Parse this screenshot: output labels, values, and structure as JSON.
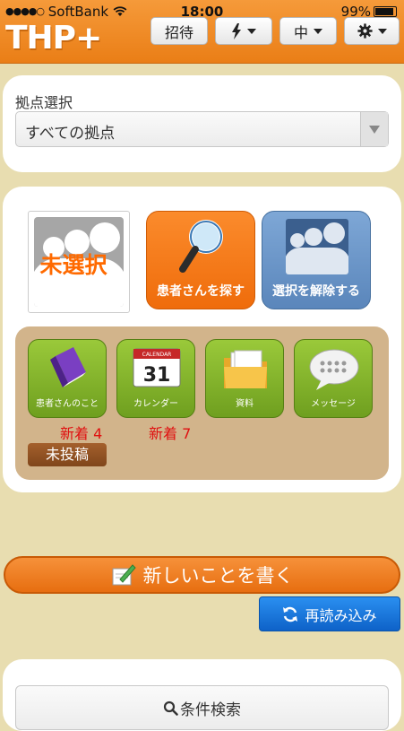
{
  "status": {
    "carrier": "SoftBank",
    "time": "18:00",
    "battery": "99%"
  },
  "header": {
    "logo": "THP+",
    "invite_label": "招待",
    "font_size_label": "中"
  },
  "location": {
    "label": "拠点選択",
    "selected": "すべての拠点"
  },
  "patient": {
    "unselected_text": "未選択",
    "find_label": "患者さんを探す",
    "clear_label": "選択を解除する"
  },
  "menu": {
    "items": [
      {
        "label": "患者さんのこと",
        "badge": "新着 4",
        "icon": "book-icon"
      },
      {
        "label": "カレンダー",
        "badge": "新着 7",
        "icon": "calendar-icon",
        "calendar_day": "31",
        "calendar_header": "CALENDAR"
      },
      {
        "label": "資料",
        "badge": "",
        "icon": "folder-icon"
      },
      {
        "label": "メッセージ",
        "badge": "",
        "icon": "speech-bubble-icon"
      }
    ],
    "unposted_label": "未投稿"
  },
  "actions": {
    "write_label": "新しいことを書く",
    "reload_label": "再読み込み"
  },
  "search": {
    "label": "条件検索"
  },
  "colors": {
    "header": "#ea7e16",
    "page_bg": "#e8ddb0",
    "accent_green": "#7fae27",
    "reload_blue": "#1a73da",
    "new_red": "#e01010"
  }
}
